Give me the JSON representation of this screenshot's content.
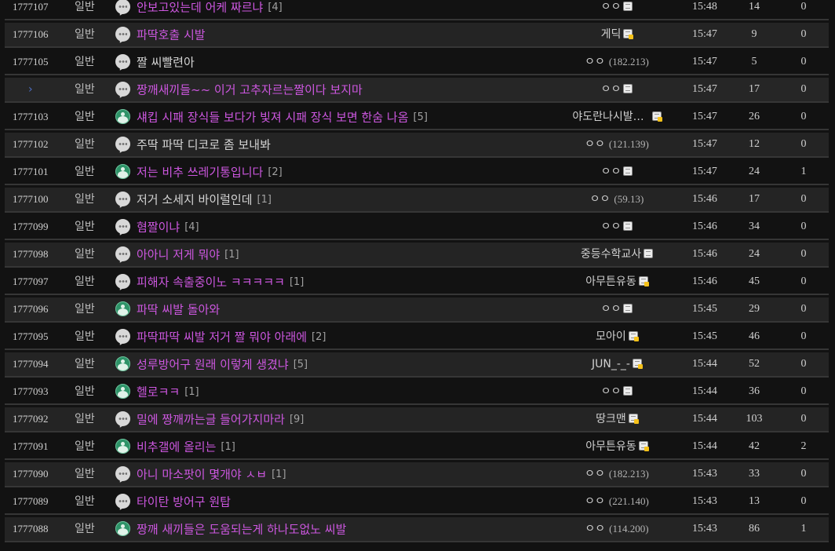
{
  "rows": [
    {
      "num": "1777107",
      "category": "일반",
      "icon": "speech-bubble-icon",
      "title": "안보고있는데 어케 짜르냐",
      "reply": "[4]",
      "writer": "ㅇㅇ",
      "ip": "",
      "badge": "member",
      "time": "15:48",
      "views": "14",
      "recommends": "0"
    },
    {
      "num": "1777106",
      "category": "일반",
      "icon": "speech-bubble-icon",
      "title": "파딱호출 시발",
      "reply": "",
      "writer": "게딕",
      "ip": "",
      "badge": "fixed",
      "time": "15:47",
      "views": "9",
      "recommends": "0"
    },
    {
      "num": "1777105",
      "category": "일반",
      "icon": "speech-bubble-icon",
      "title": "짤 씨빨련아",
      "reply": "",
      "writer": "ㅇㅇ",
      "ip": "(182.213)",
      "badge": "",
      "time": "15:47",
      "views": "5",
      "recommends": "0"
    },
    {
      "num": "",
      "category": "일반",
      "icon": "speech-bubble-icon",
      "title": "짱깨새끼들~~ 이거 고추자르는짤이다 보지마",
      "reply": "",
      "writer": "ㅇㅇ",
      "ip": "",
      "badge": "member",
      "time": "15:47",
      "views": "17",
      "recommends": "0"
    },
    {
      "num": "1777103",
      "category": "일반",
      "icon": "image-icon",
      "title": "섀킵 시패 장식들 보다가 빛져 시패 장식 보면 한숨 나옴",
      "reply": "[5]",
      "writer": "야도란나시발…",
      "ip": "",
      "badge": "fixed",
      "time": "15:47",
      "views": "26",
      "recommends": "0"
    },
    {
      "num": "1777102",
      "category": "일반",
      "icon": "speech-bubble-icon",
      "title": "주딱 파딱 디코로 좀 보내봐",
      "reply": "",
      "writer": "ㅇㅇ",
      "ip": "(121.139)",
      "badge": "",
      "time": "15:47",
      "views": "12",
      "recommends": "0"
    },
    {
      "num": "1777101",
      "category": "일반",
      "icon": "image-icon",
      "title": "저는 비추 쓰레기통입니다",
      "reply": "[2]",
      "writer": "ㅇㅇ",
      "ip": "",
      "badge": "member",
      "time": "15:47",
      "views": "24",
      "recommends": "1"
    },
    {
      "num": "1777100",
      "category": "일반",
      "icon": "speech-bubble-icon",
      "title": "저거 소세지 바이럴인데",
      "reply": "[1]",
      "writer": "ㅇㅇ",
      "ip": "(59.13)",
      "badge": "",
      "time": "15:46",
      "views": "17",
      "recommends": "0"
    },
    {
      "num": "1777099",
      "category": "일반",
      "icon": "speech-bubble-icon",
      "title": "혐짤이냐",
      "reply": "[4]",
      "writer": "ㅇㅇ",
      "ip": "",
      "badge": "member",
      "time": "15:46",
      "views": "34",
      "recommends": "0"
    },
    {
      "num": "1777098",
      "category": "일반",
      "icon": "speech-bubble-icon",
      "title": "아아니 저게 뭐야",
      "reply": "[1]",
      "writer": "중등수학교사",
      "ip": "",
      "badge": "member",
      "time": "15:46",
      "views": "24",
      "recommends": "0"
    },
    {
      "num": "1777097",
      "category": "일반",
      "icon": "speech-bubble-icon",
      "title": "피해자 속출중이노 ㅋㅋㅋㅋㅋ",
      "reply": "[1]",
      "writer": "아무튼유동",
      "ip": "",
      "badge": "fixed",
      "time": "15:46",
      "views": "45",
      "recommends": "0"
    },
    {
      "num": "1777096",
      "category": "일반",
      "icon": "image-icon",
      "title": "파딱 씨발 돌아와",
      "reply": "",
      "writer": "ㅇㅇ",
      "ip": "",
      "badge": "member",
      "time": "15:45",
      "views": "29",
      "recommends": "0"
    },
    {
      "num": "1777095",
      "category": "일반",
      "icon": "speech-bubble-icon",
      "title": "파딱파딱 씨발 저거 짤 뭐야 아래에",
      "reply": "[2]",
      "writer": "모아이",
      "ip": "",
      "badge": "fixed",
      "time": "15:45",
      "views": "46",
      "recommends": "0"
    },
    {
      "num": "1777094",
      "category": "일반",
      "icon": "image-icon",
      "title": "성루방어구 원래 이렇게 생겼냐",
      "reply": "[5]",
      "writer": "JUN_-_-",
      "ip": "",
      "badge": "fixed",
      "time": "15:44",
      "views": "52",
      "recommends": "0"
    },
    {
      "num": "1777093",
      "category": "일반",
      "icon": "image-icon",
      "title": "헬로ㅋㅋ",
      "reply": "[1]",
      "writer": "ㅇㅇ",
      "ip": "",
      "badge": "member",
      "time": "15:44",
      "views": "36",
      "recommends": "0"
    },
    {
      "num": "1777092",
      "category": "일반",
      "icon": "speech-bubble-icon",
      "title": "밀에 짱깨까는글 들어가지마라",
      "reply": "[9]",
      "writer": "땅크맨",
      "ip": "",
      "badge": "fixed",
      "time": "15:44",
      "views": "103",
      "recommends": "0"
    },
    {
      "num": "1777091",
      "category": "일반",
      "icon": "image-icon",
      "title": "비추갤에 올리는",
      "reply": "[1]",
      "writer": "아무튼유동",
      "ip": "",
      "badge": "fixed",
      "time": "15:44",
      "views": "42",
      "recommends": "2"
    },
    {
      "num": "1777090",
      "category": "일반",
      "icon": "speech-bubble-icon",
      "title": "아니 마소팟이 몇개야 ㅅㅂ",
      "reply": "[1]",
      "writer": "ㅇㅇ",
      "ip": "(182.213)",
      "badge": "",
      "time": "15:43",
      "views": "33",
      "recommends": "0"
    },
    {
      "num": "1777089",
      "category": "일반",
      "icon": "speech-bubble-icon",
      "title": "타이탄 방어구 원탑",
      "reply": "",
      "writer": "ㅇㅇ",
      "ip": "(221.140)",
      "badge": "",
      "time": "15:43",
      "views": "13",
      "recommends": "0"
    },
    {
      "num": "1777088",
      "category": "일반",
      "icon": "image-icon",
      "title": "짱깨 새끼들은 도움되는게 하나도없노 씨발",
      "reply": "",
      "writer": "ㅇㅇ",
      "ip": "(114.200)",
      "badge": "",
      "time": "15:43",
      "views": "86",
      "recommends": "1"
    }
  ]
}
